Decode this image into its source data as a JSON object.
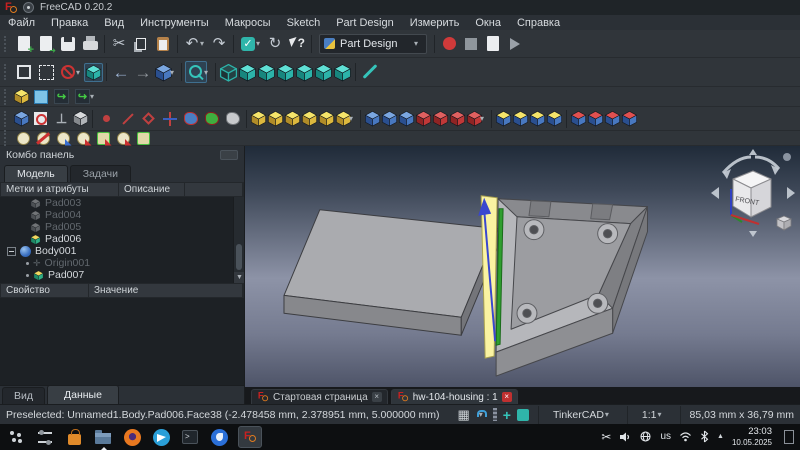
{
  "window": {
    "title": "FreeCAD 0.20.2"
  },
  "menu": {
    "items": [
      "Файл",
      "Правка",
      "Вид",
      "Инструменты",
      "Макросы",
      "Sketch",
      "Part Design",
      "Измерить",
      "Окна",
      "Справка"
    ]
  },
  "toolbars": {
    "standard_icons": [
      "new-file",
      "open-file",
      "save",
      "print",
      "cut",
      "copy",
      "paste",
      "undo",
      "redo",
      "validate",
      "refresh",
      "whats-this"
    ],
    "workbench_selector": "Part Design",
    "macro_icons": [
      "record-macro",
      "stop-macro",
      "macros-dialog",
      "execute-macro"
    ],
    "view_icons": [
      "fit-all",
      "fit-selection",
      "draw-style",
      "select-mode",
      "back",
      "forward",
      "isometric-view",
      "zoom",
      "axonometric-view",
      "front-view",
      "top-view",
      "right-view",
      "rear-view",
      "bottom-view",
      "left-view",
      "clip-plane"
    ],
    "sketch_icons": [
      "create-body",
      "create-sketch",
      "edit-sketch",
      "map-sketch"
    ],
    "datum_icons": [
      "check-geometry",
      "validate-sketch",
      "create-datum",
      "binder-box",
      "datum-point",
      "datum-line",
      "datum-plane",
      "local-coordinate-system",
      "shape-binder",
      "clone",
      "shape"
    ],
    "modeling_icons": [
      "pad",
      "revolution",
      "additive-loft",
      "additive-pipe",
      "additive-helix",
      "additive-box",
      "pocket",
      "hole",
      "groove",
      "subtractive-loft",
      "subtractive-pipe",
      "subtractive-helix",
      "subtractive-box",
      "mirrored",
      "linear-pattern",
      "polar-pattern",
      "multi-transform",
      "fillet",
      "chamfer",
      "draft",
      "thickness"
    ],
    "measure_icons": [
      "measure-linear",
      "measure-angular",
      "measure-refresh",
      "measure-clear-all",
      "measure-toggle-all",
      "measure-toggle-3d",
      "measure-toggle-delta"
    ]
  },
  "combo_panel": {
    "title": "Комбо панель",
    "tabs": [
      {
        "label": "Модель"
      },
      {
        "label": "Задачи"
      }
    ],
    "tree_headers": [
      "Метки и атрибуты",
      "Описание"
    ],
    "tree": [
      {
        "label": "Pad003"
      },
      {
        "label": "Pad004"
      },
      {
        "label": "Pad005"
      },
      {
        "label": "Pad006"
      },
      {
        "label": "Body001"
      },
      {
        "label": "Origin001"
      },
      {
        "label": "Pad007"
      }
    ],
    "property_headers": [
      "Свойство",
      "Значение"
    ],
    "bottom_tabs": [
      {
        "label": "Вид"
      },
      {
        "label": "Данные"
      }
    ]
  },
  "viewport": {
    "nav_cube_front_label": "FRONT"
  },
  "doc_tabs": [
    {
      "label": "Стартовая страница",
      "close": "×"
    },
    {
      "label": "hw-104-housing : 1",
      "close": "×"
    }
  ],
  "status_bar": {
    "message": "Preselected: Unnamed1.Body.Pad006.Face38 (-2.478458 mm, 2.378951 mm, 5.000000 mm)",
    "nav_style": "TinkerCAD",
    "scale": "1:1",
    "dimensions": "85,03 mm x 36,79 mm"
  },
  "taskbar": {
    "keyboard_layout": "us",
    "time": "23:03",
    "date": "10.05.2025"
  },
  "colors": {
    "accent_teal": "#2cb3a9",
    "preselect_yellow": "#faf3a2",
    "highlight_green": "#2f9e2f",
    "axis_blue": "#3947cf"
  }
}
